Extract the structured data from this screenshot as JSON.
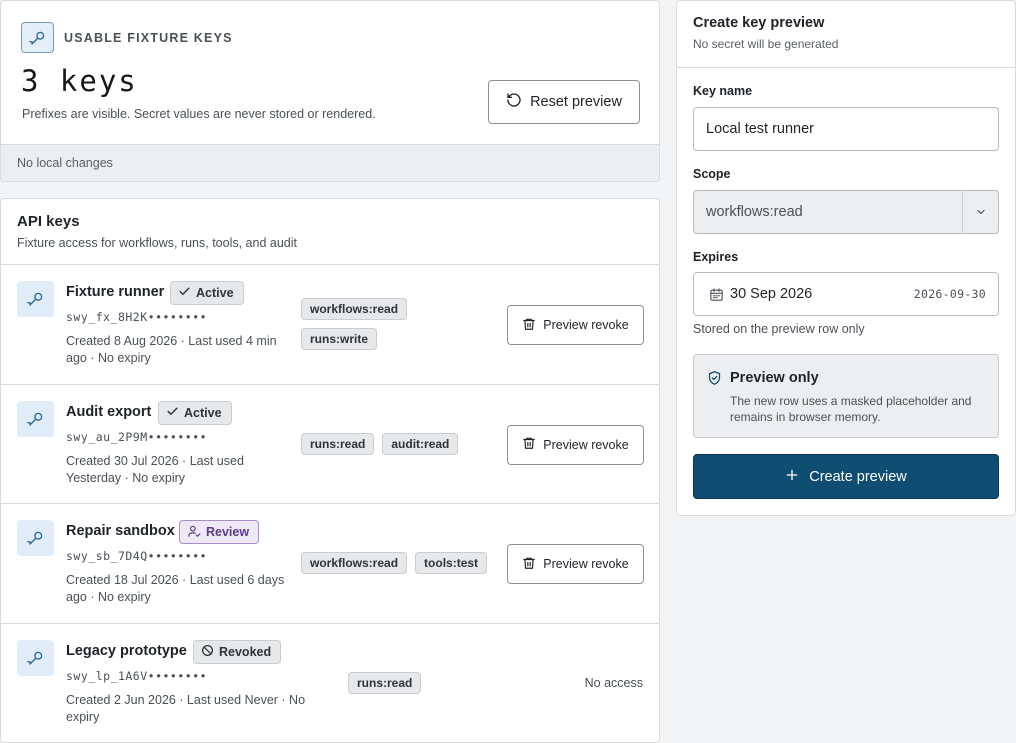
{
  "summary": {
    "label": "USABLE FIXTURE KEYS",
    "count": "3 keys",
    "description": "Prefixes are visible. Secret values are never stored or rendered.",
    "reset_label": "Reset preview",
    "status": "No local changes",
    "icon": "key-icon"
  },
  "keys_panel": {
    "title": "API keys",
    "subtitle": "Fixture access for workflows, runs, tools, and audit",
    "revoke_label": "Preview revoke",
    "rows": [
      {
        "name": "Fixture runner",
        "status": "Active",
        "prefix": "swy_fx_8H2K••••••••",
        "meta": "Created 8 Aug 2026 · Last used 4 min ago · No expiry",
        "scopes": [
          "workflows:read",
          "runs:write"
        ]
      },
      {
        "name": "Audit export",
        "status": "Active",
        "prefix": "swy_au_2P9M••••••••",
        "meta": "Created 30 Jul 2026 · Last used Yesterday · No expiry",
        "scopes": [
          "runs:read",
          "audit:read"
        ]
      },
      {
        "name": "Repair sandbox",
        "status": "Review",
        "prefix": "swy_sb_7D4Q••••••••",
        "meta": "Created 18 Jul 2026 · Last used 6 days ago · No expiry",
        "scopes": [
          "workflows:read",
          "tools:test"
        ]
      },
      {
        "name": "Legacy prototype",
        "status": "Revoked",
        "prefix": "swy_lp_1A6V••••••••",
        "meta": "Created 2 Jun 2026 · Last used Never · No expiry",
        "scopes": [
          "runs:read"
        ],
        "action_text": "No access"
      }
    ]
  },
  "create": {
    "title": "Create key preview",
    "subtitle": "No secret will be generated",
    "name_label": "Key name",
    "name_value": "Local test runner",
    "scope_label": "Scope",
    "scope_value": "workflows:read",
    "expires_label": "Expires",
    "expires_display": "30 Sep 2026",
    "expires_iso": "2026-09-30",
    "hint": "Stored on the preview row only",
    "notice_title": "Preview only",
    "notice_text": "The new row uses a masked placeholder and remains in browser memory.",
    "button_label": "Create preview"
  },
  "colors": {
    "accent": "#0f4d73",
    "review": "#5a3d86",
    "icon_bg": "#e0edf8"
  }
}
